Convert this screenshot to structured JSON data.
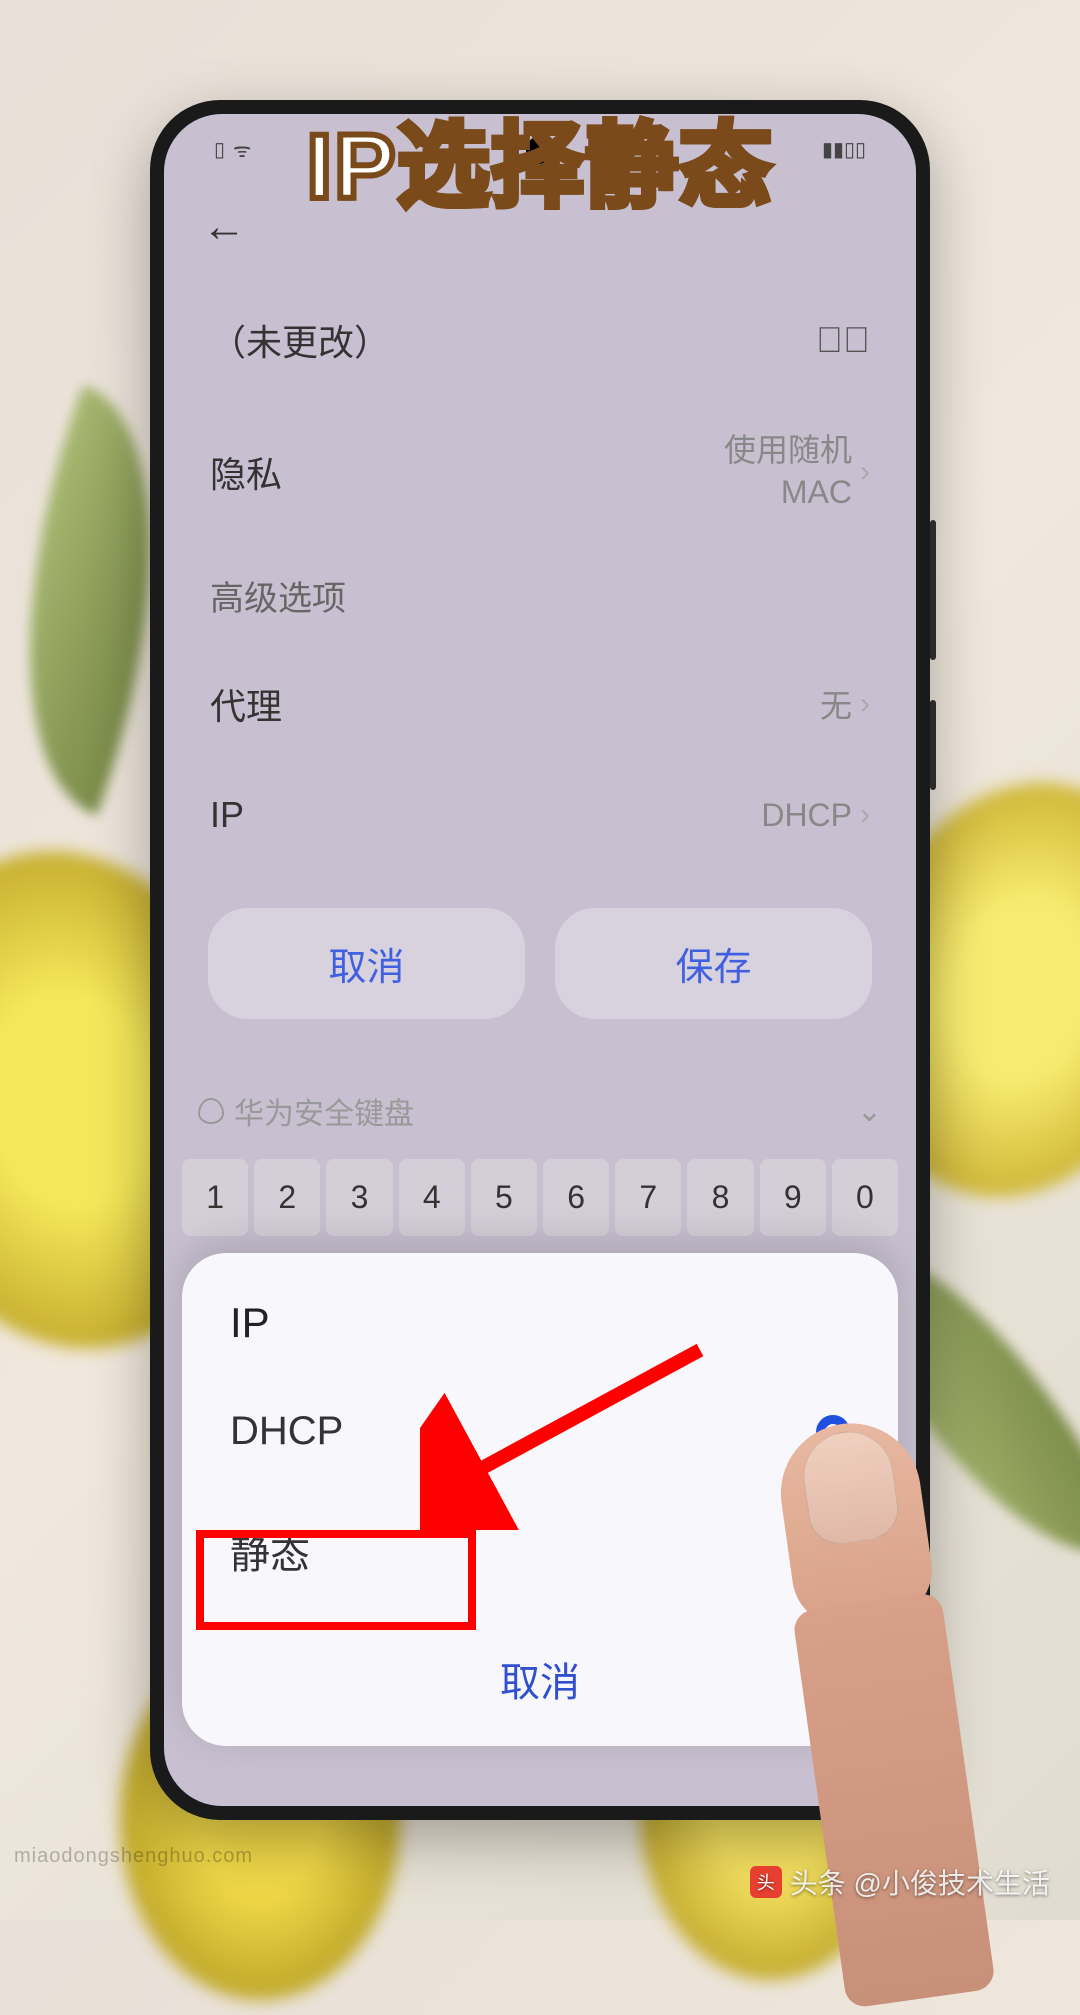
{
  "caption": {
    "part1": "IP选择",
    "part2": "静态"
  },
  "settings": {
    "password_placeholder": "（未更改）",
    "privacy": {
      "label": "隐私",
      "value_line1": "使用随机",
      "value_line2": "MAC"
    },
    "advanced": "高级选项",
    "proxy": {
      "label": "代理",
      "value": "无"
    },
    "ip": {
      "label": "IP",
      "value": "DHCP"
    },
    "cancel": "取消",
    "save": "保存"
  },
  "keyboard": {
    "name": "华为安全键盘",
    "row": [
      "1",
      "2",
      "3",
      "4",
      "5",
      "6",
      "7",
      "8",
      "9",
      "0"
    ]
  },
  "popup": {
    "title": "IP",
    "option1": "DHCP",
    "option2": "静态",
    "cancel": "取消"
  },
  "watermark": {
    "source": "头条 @小俊技术生活",
    "url": "miaodongshenghuo.com"
  }
}
